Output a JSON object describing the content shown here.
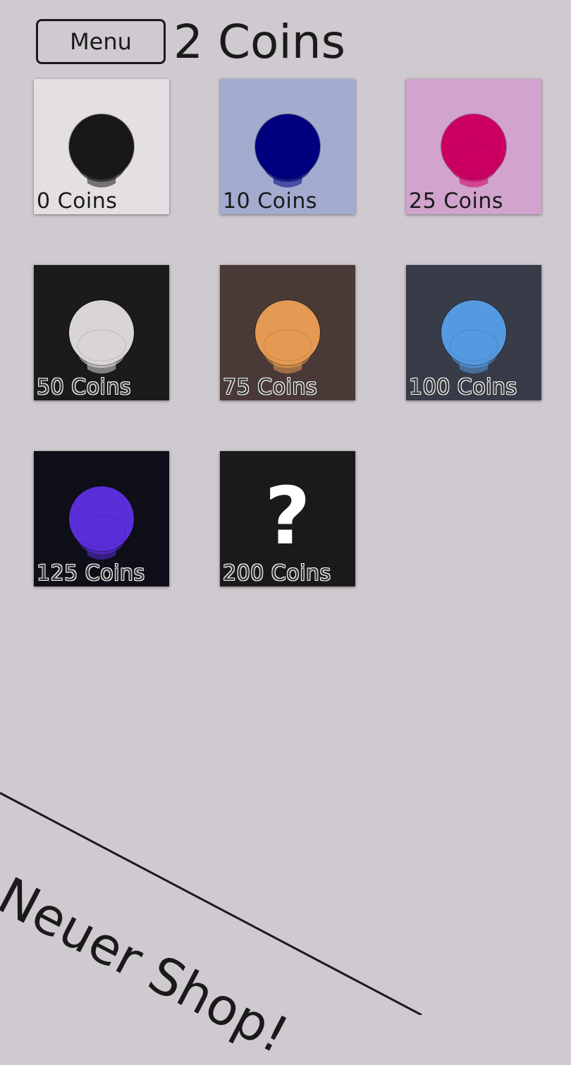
{
  "header": {
    "menu_label": "Menu",
    "coins_label": "2 Coins"
  },
  "shop": {
    "items": [
      {
        "price_label": "0 Coins",
        "bg": "#e3dfe3",
        "bulb": "#181818",
        "label_style": "light",
        "icon": "bulb-icon"
      },
      {
        "price_label": "10 Coins",
        "bg": "#a3abcf",
        "bulb": "#00007f",
        "label_style": "light",
        "icon": "bulb-icon"
      },
      {
        "price_label": "25 Coins",
        "bg": "#d1a3cd",
        "bulb": "#cc0062",
        "label_style": "light",
        "icon": "bulb-icon"
      },
      {
        "price_label": "50 Coins",
        "bg": "#1b1b1b",
        "bulb": "#d8d4d8",
        "label_style": "outline",
        "icon": "bulb-icon"
      },
      {
        "price_label": "75 Coins",
        "bg": "#4a3a37",
        "bulb": "#e49a52",
        "label_style": "outline",
        "icon": "bulb-icon"
      },
      {
        "price_label": "100 Coins",
        "bg": "#383b48",
        "bulb": "#5599e0",
        "label_style": "outline",
        "icon": "bulb-icon"
      },
      {
        "price_label": "125 Coins",
        "bg": "#0e0f18",
        "bulb": "#5a2ed8",
        "label_style": "outline",
        "icon": "bulb-icon"
      },
      {
        "price_label": "200 Coins",
        "bg": "#1a1a1a",
        "bulb": null,
        "label_style": "outline",
        "icon": "question-mark-icon",
        "mystery_symbol": "?"
      }
    ]
  },
  "banner": {
    "text": "Neuer Shop!"
  }
}
